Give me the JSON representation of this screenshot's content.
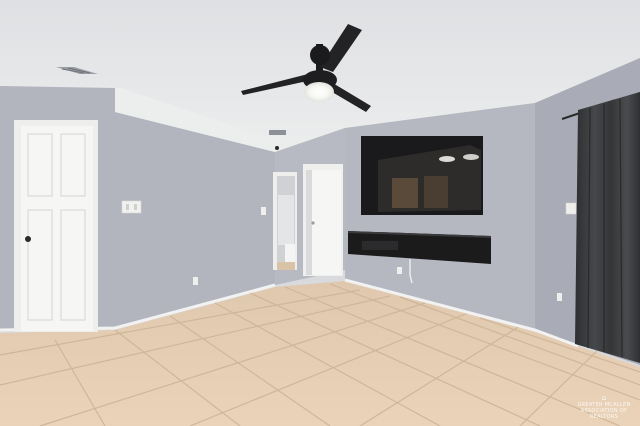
{
  "scene": {
    "subject": "empty-living-room",
    "colors": {
      "ceiling": "#e6e7e9",
      "wall": "#b4b7c0",
      "wall_shadow": "#a5a8b2",
      "floor": "#e5cdb1",
      "grout": "#cdb497",
      "door": "#f5f5f3",
      "tv": "#1b1b1d",
      "curtain": "#3c3d3f"
    },
    "watermark": {
      "text_line1": "GREATER MCALLEN",
      "text_line2": "ASSOCIATION OF REALTORS"
    }
  }
}
